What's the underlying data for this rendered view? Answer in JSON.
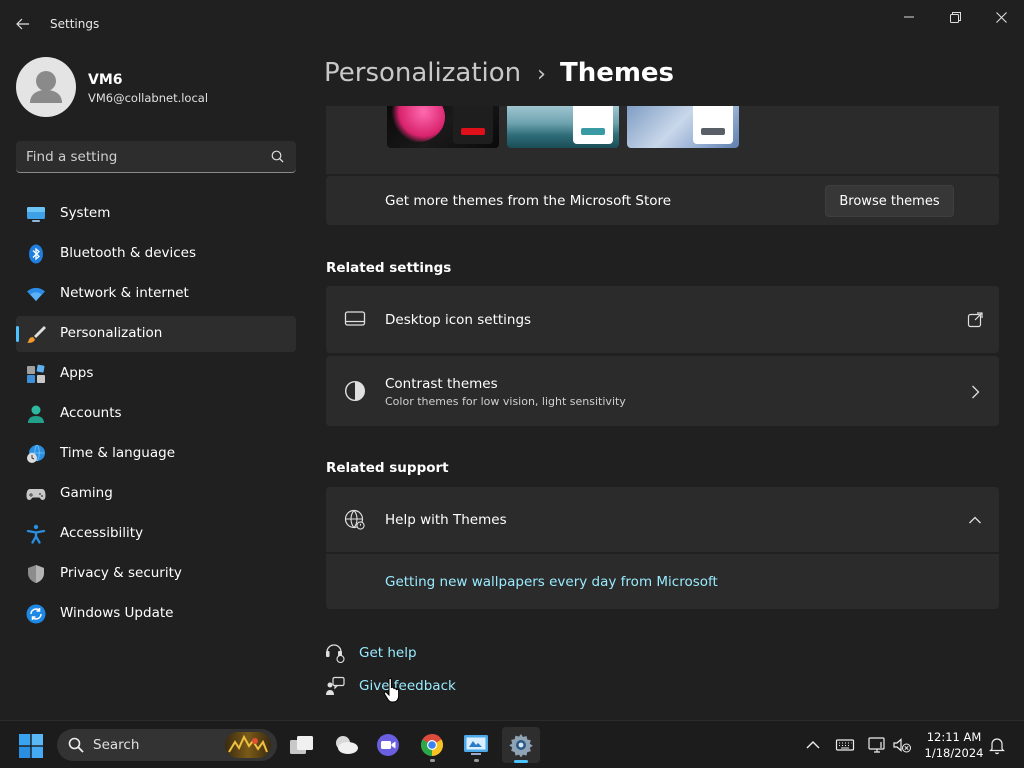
{
  "window": {
    "app_title": "Settings"
  },
  "profile": {
    "name": "VM6",
    "email": "VM6@collabnet.local"
  },
  "search": {
    "placeholder": "Find a setting"
  },
  "nav": {
    "items": [
      {
        "label": "System"
      },
      {
        "label": "Bluetooth & devices"
      },
      {
        "label": "Network & internet"
      },
      {
        "label": "Personalization"
      },
      {
        "label": "Apps"
      },
      {
        "label": "Accounts"
      },
      {
        "label": "Time & language"
      },
      {
        "label": "Gaming"
      },
      {
        "label": "Accessibility"
      },
      {
        "label": "Privacy & security"
      },
      {
        "label": "Windows Update"
      }
    ],
    "selected": "Personalization"
  },
  "breadcrumb": {
    "parent": "Personalization",
    "separator": "›",
    "current": "Themes"
  },
  "store": {
    "text": "Get more themes from the Microsoft Store",
    "button": "Browse themes"
  },
  "related_settings": {
    "heading": "Related settings",
    "desktop_icon": {
      "title": "Desktop icon settings"
    },
    "contrast": {
      "title": "Contrast themes",
      "subtitle": "Color themes for low vision, light sensitivity"
    }
  },
  "related_support": {
    "heading": "Related support",
    "help_title": "Help with Themes",
    "link": "Getting new wallpapers every day from Microsoft"
  },
  "footer_links": {
    "get_help": "Get help",
    "feedback": "Give feedback"
  },
  "taskbar": {
    "search_label": "Search",
    "time": "12:11 AM",
    "date": "1/18/2024"
  },
  "colors": {
    "accent": "#4cc2ff",
    "link": "#99ebff",
    "card": "#2b2b2b",
    "background": "#202020"
  }
}
